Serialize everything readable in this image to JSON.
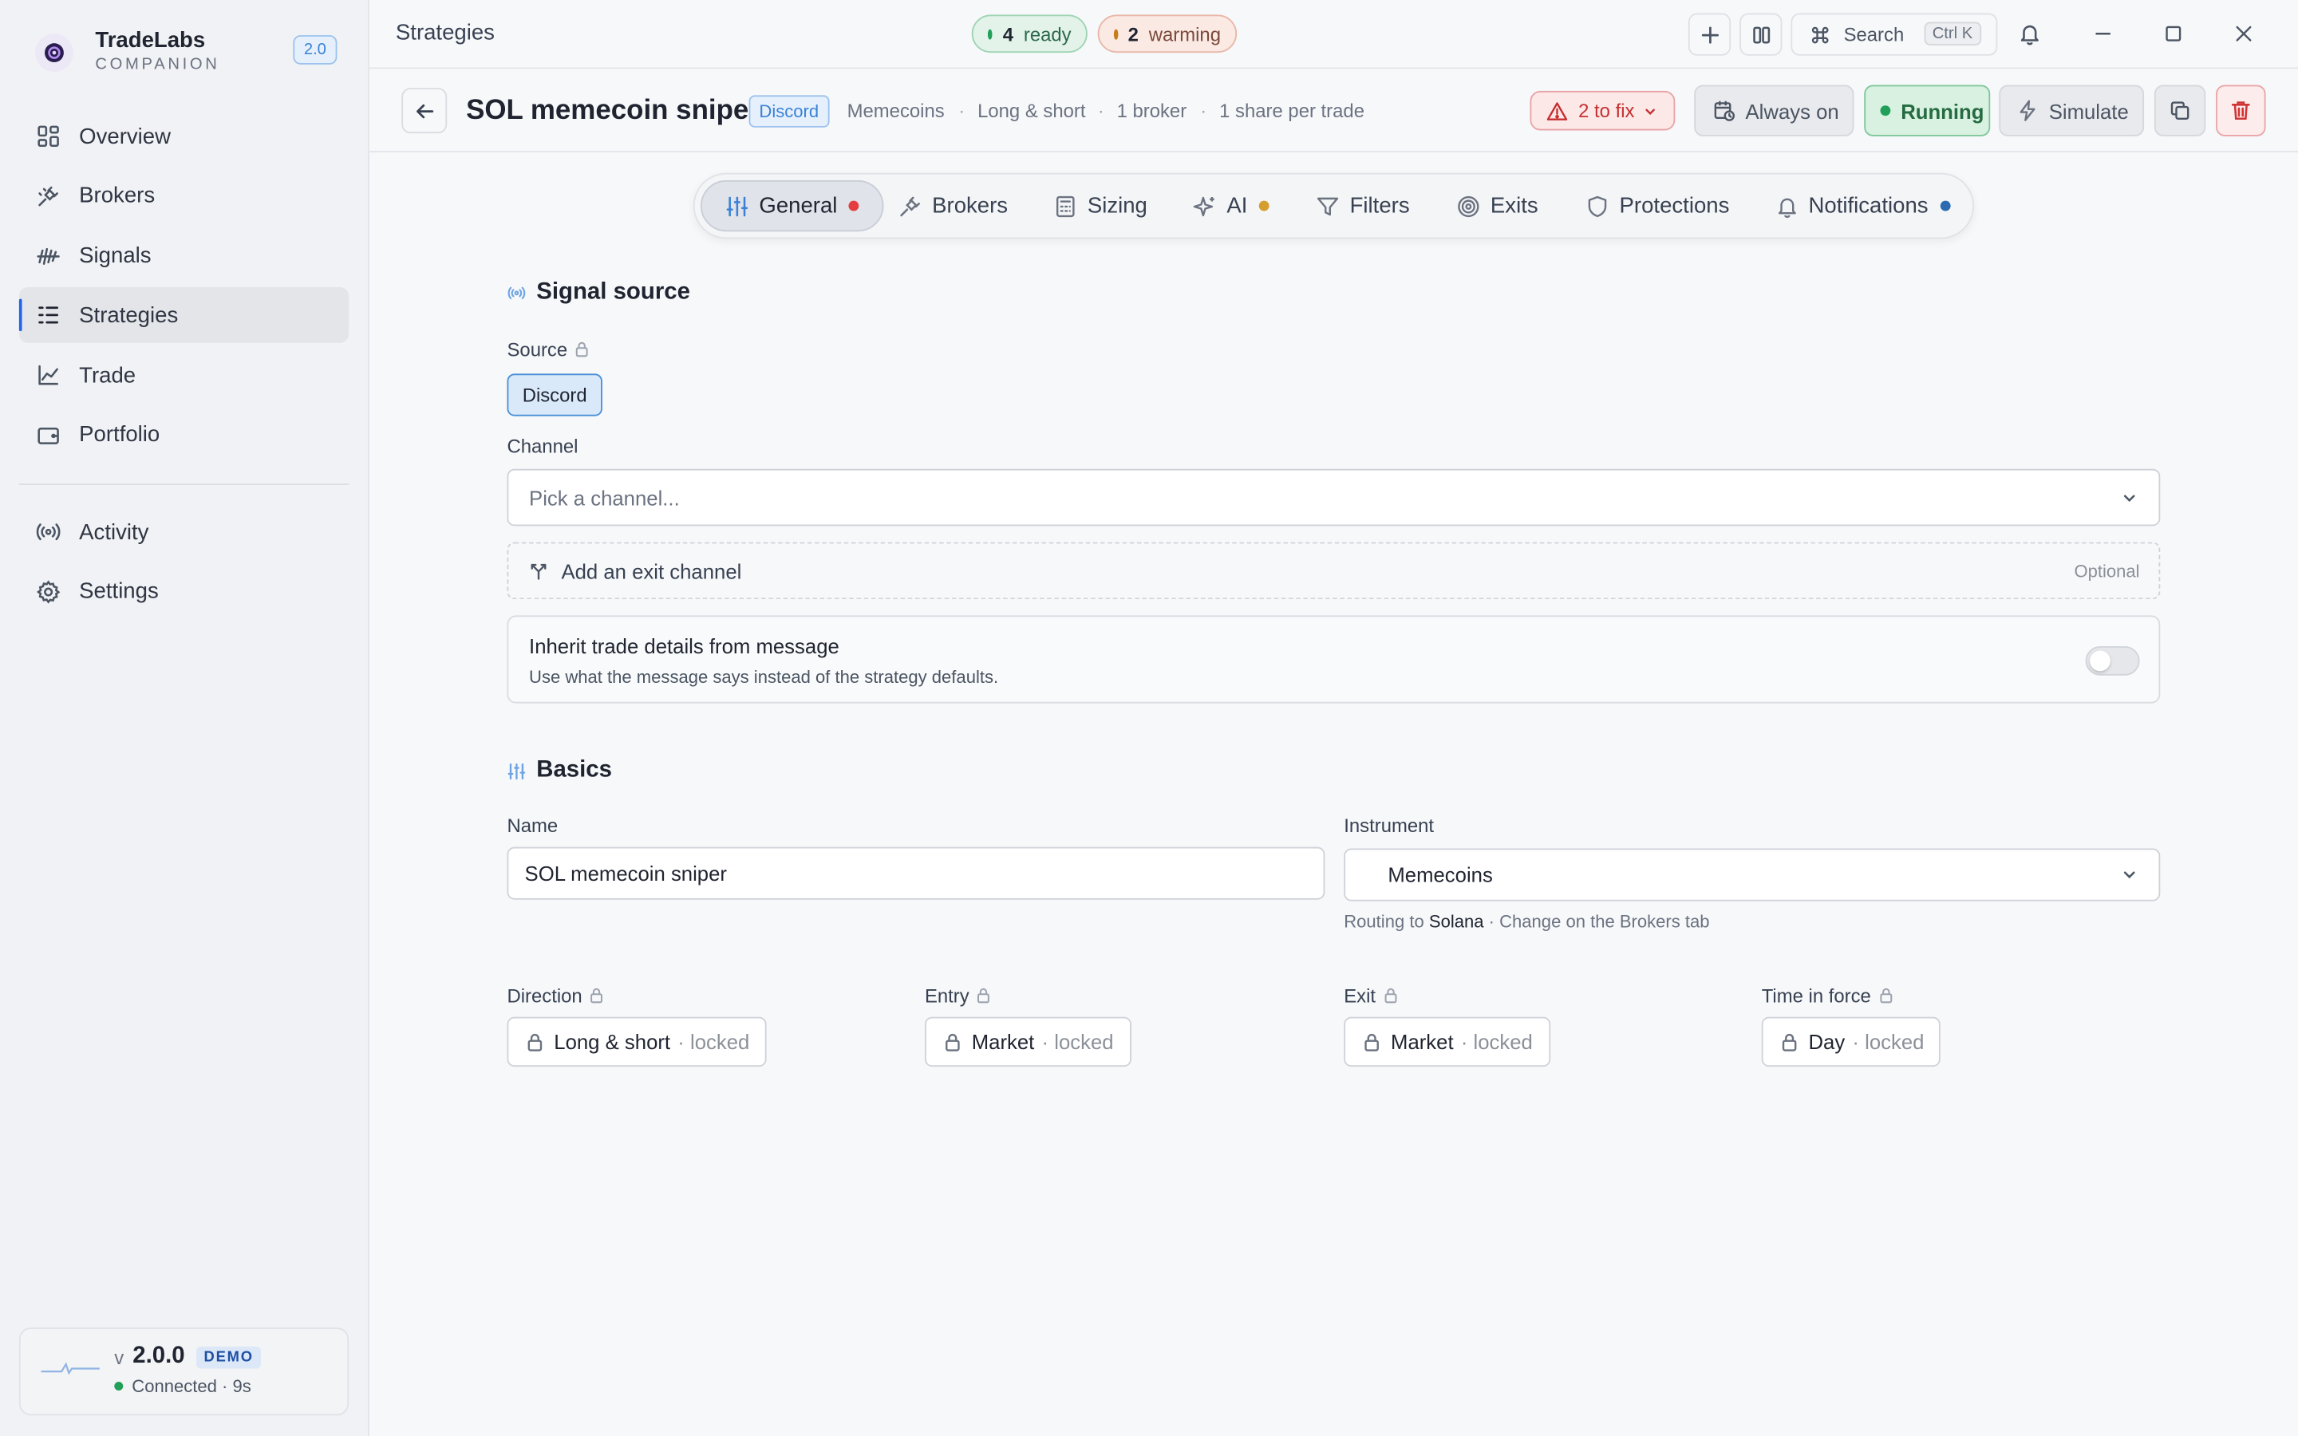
{
  "app": {
    "name": "TradeLabs",
    "subtitle": "COMPANION",
    "version_badge": "2.0"
  },
  "sidebar": {
    "items": [
      {
        "label": "Overview",
        "icon": "grid-icon"
      },
      {
        "label": "Brokers",
        "icon": "plug-icon"
      },
      {
        "label": "Signals",
        "icon": "signal-bars-icon"
      },
      {
        "label": "Strategies",
        "icon": "list-icon",
        "active": true
      },
      {
        "label": "Trade",
        "icon": "line-chart-icon"
      },
      {
        "label": "Portfolio",
        "icon": "wallet-icon"
      }
    ],
    "secondary": [
      {
        "label": "Activity",
        "icon": "broadcast-icon"
      },
      {
        "label": "Settings",
        "icon": "gear-icon"
      }
    ],
    "status": {
      "version_prefix": "v",
      "version": "2.0.0",
      "badge": "DEMO",
      "connection": "Connected · 9s"
    }
  },
  "topbar": {
    "title": "Strategies",
    "ready_count": "4",
    "ready_label": "ready",
    "warming_count": "2",
    "warming_label": "warming",
    "search_label": "Search",
    "search_shortcut": "Ctrl K"
  },
  "header": {
    "name": "SOL memecoin sniper",
    "source_badge": "Discord",
    "meta": [
      "Memecoins",
      "Long & short",
      "1 broker",
      "1 share per trade"
    ],
    "fix_label": "2 to fix",
    "schedule_label": "Always on",
    "status_label": "Running",
    "simulate_label": "Simulate"
  },
  "tabs": [
    {
      "label": "General",
      "icon": "sliders-icon",
      "dot": "#e53e3e",
      "active": true
    },
    {
      "label": "Brokers",
      "icon": "plug-icon"
    },
    {
      "label": "Sizing",
      "icon": "calculator-icon"
    },
    {
      "label": "AI",
      "icon": "sparkles-icon",
      "dot": "#d69e2e"
    },
    {
      "label": "Filters",
      "icon": "filter-icon"
    },
    {
      "label": "Exits",
      "icon": "target-icon"
    },
    {
      "label": "Protections",
      "icon": "shield-icon"
    },
    {
      "label": "Notifications",
      "icon": "bell-icon",
      "dot": "#2b6cb0"
    }
  ],
  "signal_source": {
    "heading": "Signal source",
    "source_label": "Source",
    "source_value": "Discord",
    "channel_label": "Channel",
    "channel_placeholder": "Pick a channel...",
    "exit_channel_label": "Add an exit channel",
    "exit_channel_optional": "Optional",
    "inherit_title": "Inherit trade details from message",
    "inherit_desc": "Use what the message says instead of the strategy defaults.",
    "inherit_enabled": false
  },
  "basics": {
    "heading": "Basics",
    "name_label": "Name",
    "name_value": "SOL memecoin sniper",
    "instrument_label": "Instrument",
    "instrument_value": "Memecoins",
    "routing_prefix": "Routing to",
    "routing_target": "Solana",
    "routing_suffix": "· Change on the Brokers tab",
    "locked_fields": [
      {
        "label": "Direction",
        "value": "Long & short",
        "suffix": "· locked"
      },
      {
        "label": "Entry",
        "value": "Market",
        "suffix": "· locked"
      },
      {
        "label": "Exit",
        "value": "Market",
        "suffix": "· locked"
      },
      {
        "label": "Time in force",
        "value": "Day",
        "suffix": "· locked"
      }
    ]
  },
  "colors": {
    "accent": "#2563eb",
    "ready": "#22a05a",
    "warming": "#c77d1a",
    "error": "#c53030"
  }
}
